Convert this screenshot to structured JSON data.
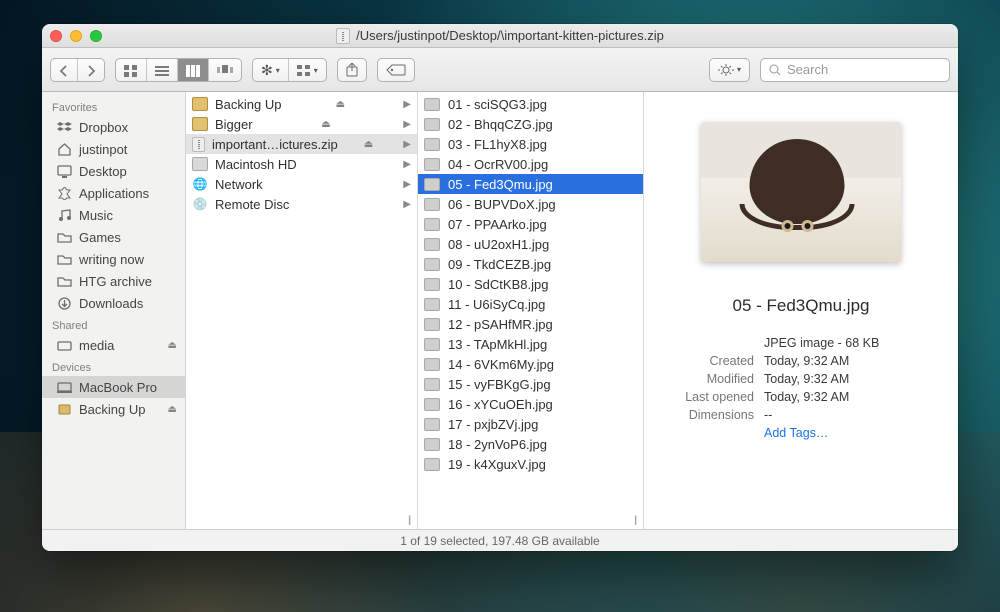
{
  "window": {
    "title": "/Users/justinpot/Desktop/\\important-kitten-pictures.zip"
  },
  "toolbar": {
    "search_placeholder": "Search"
  },
  "sidebar": {
    "sections": [
      {
        "header": "Favorites",
        "items": [
          {
            "label": "Dropbox",
            "icon": "dropbox"
          },
          {
            "label": "justinpot",
            "icon": "home"
          },
          {
            "label": "Desktop",
            "icon": "desktop"
          },
          {
            "label": "Applications",
            "icon": "apps"
          },
          {
            "label": "Music",
            "icon": "music"
          },
          {
            "label": "Games",
            "icon": "folder"
          },
          {
            "label": "writing now",
            "icon": "folder"
          },
          {
            "label": "HTG archive",
            "icon": "folder"
          },
          {
            "label": "Downloads",
            "icon": "downloads"
          }
        ]
      },
      {
        "header": "Shared",
        "items": [
          {
            "label": "media",
            "icon": "drive",
            "eject": true
          }
        ]
      },
      {
        "header": "Devices",
        "items": [
          {
            "label": "MacBook Pro",
            "icon": "mac",
            "selected": true
          },
          {
            "label": "Backing Up",
            "icon": "disk",
            "eject": true
          }
        ]
      }
    ]
  },
  "column1": [
    {
      "label": "Backing Up",
      "icon": "disk",
      "eject": true,
      "arrow": true
    },
    {
      "label": "Bigger",
      "icon": "disk",
      "eject": true,
      "arrow": true
    },
    {
      "label": "important…ictures.zip",
      "icon": "zip",
      "eject": true,
      "arrow": true,
      "selected": true
    },
    {
      "label": "Macintosh HD",
      "icon": "hd",
      "arrow": true
    },
    {
      "label": "Network",
      "icon": "net",
      "arrow": true
    },
    {
      "label": "Remote Disc",
      "icon": "cd",
      "arrow": true
    }
  ],
  "column2": [
    {
      "label": "01 - sciSQG3.jpg"
    },
    {
      "label": "02 - BhqqCZG.jpg"
    },
    {
      "label": "03 - FL1hyX8.jpg"
    },
    {
      "label": "04 - OcrRV00.jpg"
    },
    {
      "label": "05 - Fed3Qmu.jpg",
      "selected": true
    },
    {
      "label": "06 - BUPVDoX.jpg"
    },
    {
      "label": "07 - PPAArko.jpg"
    },
    {
      "label": "08 - uU2oxH1.jpg"
    },
    {
      "label": "09 - TkdCEZB.jpg"
    },
    {
      "label": "10 - SdCtKB8.jpg"
    },
    {
      "label": "11 - U6iSyCq.jpg"
    },
    {
      "label": "12 - pSAHfMR.jpg"
    },
    {
      "label": "13 - TApMkHl.jpg"
    },
    {
      "label": "14 - 6VKm6My.jpg"
    },
    {
      "label": "15 - vyFBKgG.jpg"
    },
    {
      "label": "16 - xYCuOEh.jpg"
    },
    {
      "label": "17 - pxjbZVj.jpg"
    },
    {
      "label": "18 - 2ynVoP6.jpg"
    },
    {
      "label": "19 - k4XguxV.jpg"
    }
  ],
  "preview": {
    "name": "05 - Fed3Qmu.jpg",
    "kind": "JPEG image - 68 KB",
    "created_label": "Created",
    "created": "Today, 9:32 AM",
    "modified_label": "Modified",
    "modified": "Today, 9:32 AM",
    "opened_label": "Last opened",
    "opened": "Today, 9:32 AM",
    "dims_label": "Dimensions",
    "dims": "--",
    "tags": "Add Tags…"
  },
  "status": "1 of 19 selected, 197.48 GB available"
}
